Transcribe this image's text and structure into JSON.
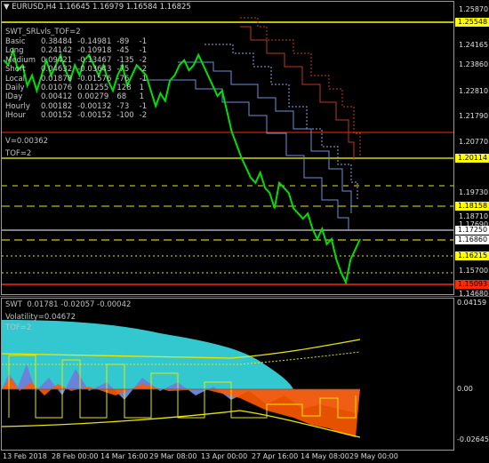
{
  "header": {
    "symbol_line": "EURUSD,H4  1.16645 1.16979 1.16584 1.16825",
    "indicator_title": "SWT_SRLvls_TOF=2"
  },
  "levels_table": [
    {
      "name": "Basic",
      "v1": "0.38484",
      "v2": "-0.14981",
      "v3": "-89",
      "v4": "-1"
    },
    {
      "name": "Long",
      "v1": "0.24142",
      "v2": "-0.10918",
      "v3": "-45",
      "v4": "-1"
    },
    {
      "name": "Medium",
      "v1": "0.09421",
      "v2": "-0.13467",
      "v3": "-135",
      "v4": "-2"
    },
    {
      "name": "Short",
      "v1": "0.04632",
      "v2": "-0.03643",
      "v3": "-75",
      "v4": "-2"
    },
    {
      "name": "Local",
      "v1": "0.01878",
      "v2": "-0.01576",
      "v3": "-76",
      "v4": "-1"
    },
    {
      "name": "Daily",
      "v1": "0.01076",
      "v2": "0.01255",
      "v3": "128",
      "v4": "1"
    },
    {
      "name": "IDay",
      "v1": "0.00412",
      "v2": "0.00279",
      "v3": "68",
      "v4": "1"
    },
    {
      "name": "Hourly",
      "v1": "0.00182",
      "v2": "-0.00132",
      "v3": "-73",
      "v4": "-1"
    },
    {
      "name": "IHour",
      "v1": "0.00152",
      "v2": "-0.00152",
      "v3": "-100",
      "v4": "-2"
    }
  ],
  "v_line": "V=0.00362",
  "tof_line": "TOF=2",
  "price_axis": {
    "labels": [
      "1.25870",
      "1.24165",
      "1.23860",
      "1.22810",
      "1.21790",
      "1.20770",
      "1.19730",
      "1.18710",
      "1.17690",
      "1.15700",
      "1.14680"
    ],
    "tagged": [
      {
        "value": "1.25548",
        "bg": "#ffff00",
        "fg": "#000000"
      },
      {
        "value": "1.20114",
        "bg": "#ffff00",
        "fg": "#000000"
      },
      {
        "value": "1.18158",
        "bg": "#ffff00",
        "fg": "#000000"
      },
      {
        "value": "1.17250",
        "bg": "#ffffff",
        "fg": "#000000"
      },
      {
        "value": "1.16860",
        "bg": "#ffffff",
        "fg": "#000000"
      },
      {
        "value": "1.16215",
        "bg": "#ffff00",
        "fg": "#000000"
      },
      {
        "value": "1.15093",
        "bg": "#ff2a00",
        "fg": "#000000"
      }
    ]
  },
  "sub_panel": {
    "title": "SWT  0.01781 -0.02057 -0.00042",
    "volatility": "Volatility=0.04672",
    "tof": "TOF=2",
    "axis_labels": [
      "0.04159",
      "0.00",
      "-0.02645"
    ]
  },
  "time_axis": [
    "13 Feb 2018",
    "28 Feb 00:00",
    "14 Mar 16:00",
    "29 Mar 08:00",
    "13 Apr 00:00",
    "27 Apr 16:00",
    "14 May 08:00",
    "29 May 00:00"
  ],
  "colors": {
    "background": "#000000",
    "price": "#00e000",
    "support_line": "#ffff00",
    "stop_line": "#ff2a00",
    "band_blue": "#6f8fd8",
    "band_red": "#c83a20",
    "vol_fill": "#33c8d0",
    "osc_blue": "#6a82d8",
    "osc_orange": "#ff5a00"
  },
  "chart_data": {
    "type": "line",
    "series": [],
    "x": [
      "13 Feb 2018",
      "28 Feb 00:00",
      "14 Mar 16:00",
      "29 Mar 08:00",
      "13 Apr 00:00",
      "27 Apr 16:00",
      "14 May 08:00",
      "29 May 00:00"
    ],
    "ylim": [
      1.1468,
      1.2587
    ],
    "price_points": [
      1.238,
      1.236,
      1.242,
      1.234,
      1.236,
      1.228,
      1.232,
      1.226,
      1.232,
      1.238,
      1.232,
      1.236,
      1.24,
      1.234,
      1.23,
      1.236,
      1.232,
      1.238,
      1.24,
      1.236,
      1.232,
      1.236,
      1.23,
      1.226,
      1.232,
      1.236,
      1.228,
      1.232,
      1.236,
      1.234,
      1.232,
      1.226,
      1.22,
      1.225,
      1.222,
      1.23,
      1.232,
      1.236,
      1.238,
      1.234,
      1.236,
      1.24,
      1.236,
      1.232,
      1.228,
      1.224,
      1.226,
      1.218,
      1.21,
      1.205,
      1.2,
      1.196,
      1.192,
      1.19,
      1.194,
      1.188,
      1.186,
      1.18,
      1.19,
      1.188,
      1.186,
      1.18,
      1.178,
      1.176,
      1.178,
      1.172,
      1.168,
      1.172,
      1.166,
      1.168,
      1.16,
      1.155,
      1.151,
      1.16,
      1.164,
      1.168
    ]
  }
}
